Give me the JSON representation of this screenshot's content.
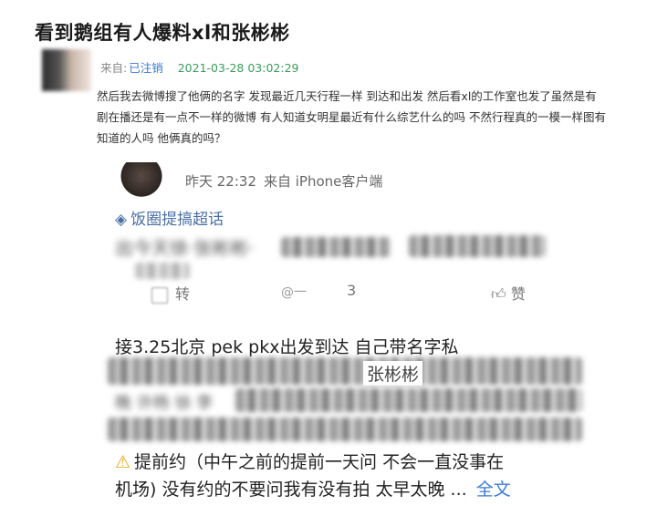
{
  "post": {
    "title": "看到鹅组有人爆料xl和张彬彬",
    "meta_prefix": "来自:",
    "author": "已注销",
    "timestamp": "2021-03-28 03:02:29",
    "body": "然后我去微博搜了他俩的名字 发现最近几天行程一样 到达和出发 然后看xl的工作室也发了虽然是有剧在播还是有一点不一样的微博 有人知道女明星最近有什么综艺什么的吗 不然行程真的一模一样图有知道的人吗 他俩真的吗？"
  },
  "screenshot": {
    "time": "昨天 22:32",
    "source": "来自 iPhone客户端",
    "topic_label": "饭圈提搞超话",
    "blurred_line": "出今天徐·张彬彬·",
    "repost_label": "转",
    "comment_count": "3",
    "like_label": "赞",
    "watermark": "@一",
    "line_clear_1": "接3.25北京 pek pkx出发到达 自己带名字私",
    "partial_name": "张彬彬",
    "blurred_line_3": "晚 许杨 徐 李",
    "warn_line": "提前约（中午之前的提前一天问 不会一直没事在",
    "last_line": "机场) 没有约的不要问我有没有拍 太早太晚",
    "ellipsis": "...",
    "full_text": "全文"
  }
}
